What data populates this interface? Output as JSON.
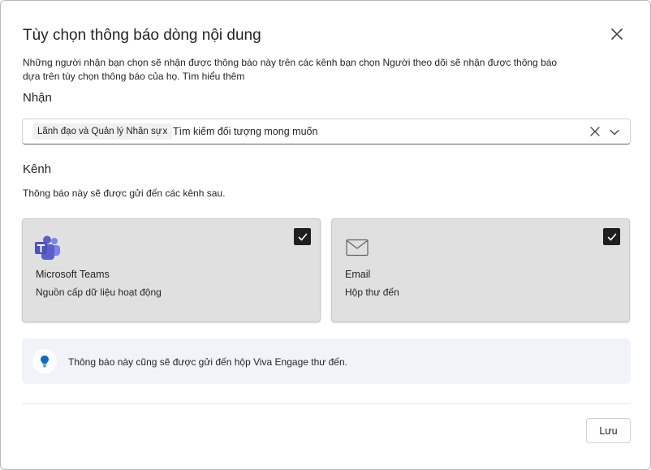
{
  "dialog": {
    "title": "Tùy chọn thông báo dòng nội dung",
    "description": "Những người nhận bạn chọn sẽ nhận được thông báo này trên các kênh bạn chọn Người theo dõi sẽ nhận được thông báo dựa trên tùy chọn thông báo của họ. Tìm hiểu thêm",
    "close_icon": "close-icon"
  },
  "recipients": {
    "label": "Nhận",
    "chips": [
      {
        "label": "Lãnh đạo và Quản lý Nhân sự",
        "remove": "x"
      }
    ],
    "search_placeholder": "Tìm kiếm đối tượng mong muốn",
    "clear_icon": "clear-icon",
    "dropdown_icon": "chevron-down-icon"
  },
  "channels": {
    "label": "Kênh",
    "subtext": "Thông báo này sẽ được gửi đến các kênh sau.",
    "items": [
      {
        "name": "Microsoft Teams",
        "sub": "Nguồn cấp dữ liệu hoạt động",
        "checked": true,
        "icon": "teams-icon"
      },
      {
        "name": "Email",
        "sub": "Hộp thư đến",
        "checked": true,
        "icon": "mail-icon"
      }
    ]
  },
  "info": {
    "text": "Thông báo này cũng sẽ được gửi đến hộp Viva Engage thư đến.",
    "icon": "lightbulb-icon"
  },
  "footer": {
    "save_label": "Lưu"
  },
  "colors": {
    "teams_purple": "#5b5fc7",
    "info_blue": "#0f6cbd",
    "card_bg": "#e0e0e0",
    "info_bg": "#f0f4f9"
  }
}
